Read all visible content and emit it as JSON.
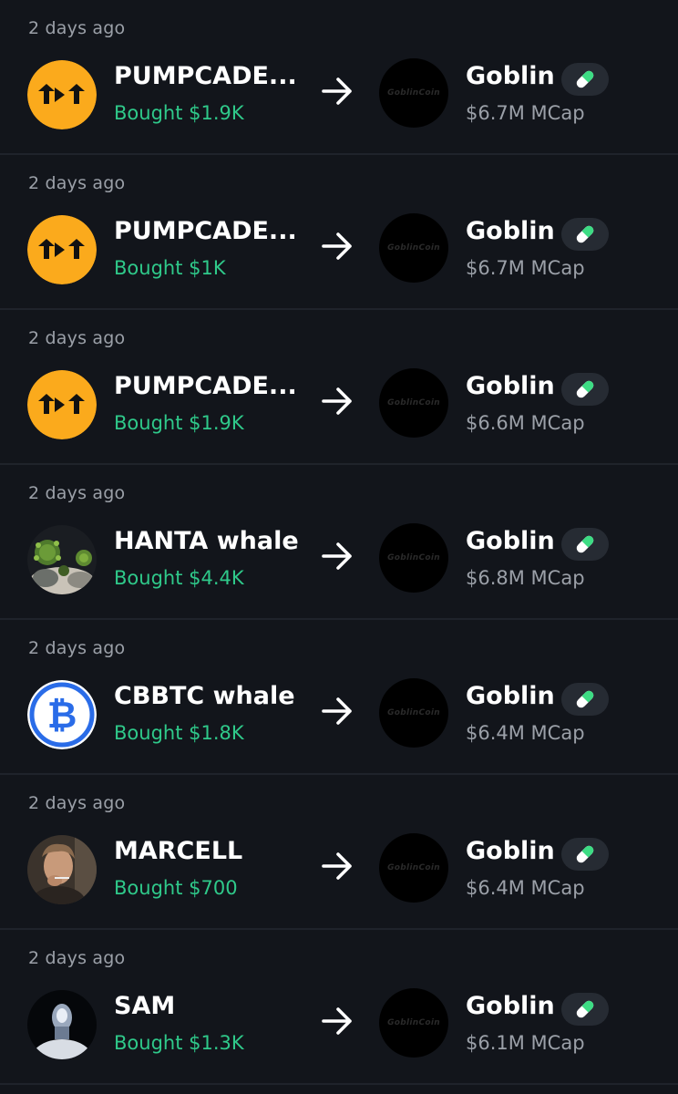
{
  "colors": {
    "background": "#12151b",
    "divider": "#1f232b",
    "bought_green": "#2fc98a",
    "muted_text": "#9ba0a8",
    "pumpcade_orange": "#fbaa1c",
    "cbbtc_blue": "#2a6ce8"
  },
  "rows": [
    {
      "time": "2 days ago",
      "trader": "PUMPCADE...",
      "avatar": "pumpcade-logo-icon",
      "bought": "Bought $1.9K",
      "token": "Goblin",
      "token_logo_text": "GoblinCoin",
      "mcap": "$6.7M MCap",
      "badge": "pill-icon"
    },
    {
      "time": "2 days ago",
      "trader": "PUMPCADE...",
      "avatar": "pumpcade-logo-icon",
      "bought": "Bought $1K",
      "token": "Goblin",
      "token_logo_text": "GoblinCoin",
      "mcap": "$6.7M MCap",
      "badge": "pill-icon"
    },
    {
      "time": "2 days ago",
      "trader": "PUMPCADE...",
      "avatar": "pumpcade-logo-icon",
      "bought": "Bought $1.9K",
      "token": "Goblin",
      "token_logo_text": "GoblinCoin",
      "mcap": "$6.6M MCap",
      "badge": "pill-icon"
    },
    {
      "time": "2 days ago",
      "trader": "HANTA whale",
      "avatar": "virus-avatar-icon",
      "bought": "Bought $4.4K",
      "token": "Goblin",
      "token_logo_text": "GoblinCoin",
      "mcap": "$6.8M MCap",
      "badge": "pill-icon"
    },
    {
      "time": "2 days ago",
      "trader": "CBBTC whale",
      "avatar": "bitcoin-logo-icon",
      "bought": "Bought $1.8K",
      "token": "Goblin",
      "token_logo_text": "GoblinCoin",
      "mcap": "$6.4M MCap",
      "badge": "pill-icon"
    },
    {
      "time": "2 days ago",
      "trader": "MARCELL",
      "avatar": "man-smoking-avatar-icon",
      "bought": "Bought $700",
      "token": "Goblin",
      "token_logo_text": "GoblinCoin",
      "mcap": "$6.4M MCap",
      "badge": "pill-icon"
    },
    {
      "time": "2 days ago",
      "trader": "SAM",
      "avatar": "hooded-figure-avatar-icon",
      "bought": "Bought $1.3K",
      "token": "Goblin",
      "token_logo_text": "GoblinCoin",
      "mcap": "$6.1M MCap",
      "badge": "pill-icon"
    }
  ]
}
